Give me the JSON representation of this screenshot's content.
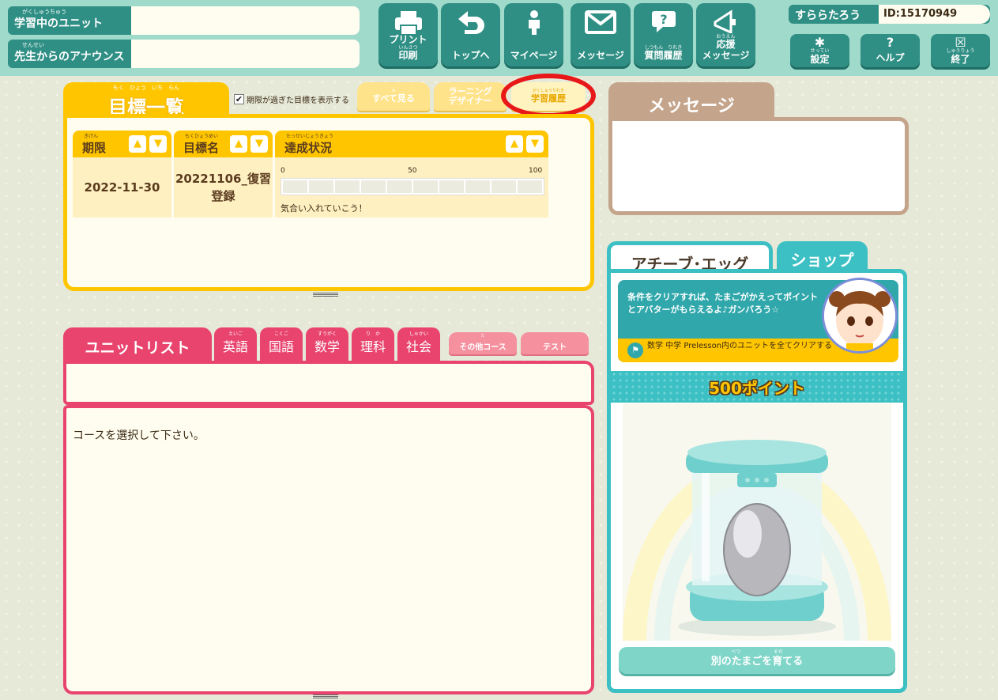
{
  "header": {
    "current_unit": {
      "ruby": "がくしゅうちゅう",
      "label": "学習中のユニット",
      "value": ""
    },
    "announce": {
      "ruby": "せんせい",
      "label": "先生からのアナウンス",
      "value": ""
    },
    "nav": [
      {
        "id": "print",
        "ruby": "いんさつ",
        "label1": "プリント",
        "label2": "印刷",
        "icon": "printer-icon"
      },
      {
        "id": "top",
        "label1": "トップへ",
        "icon": "return-arrow-icon"
      },
      {
        "id": "mypage",
        "label1": "マイページ",
        "icon": "person-icon"
      },
      {
        "id": "message",
        "label1": "メッセージ",
        "icon": "envelope-icon"
      },
      {
        "id": "question",
        "ruby": "しつもん　りれき",
        "label1": "質問履歴",
        "icon": "question-bubble-icon"
      },
      {
        "id": "cheer",
        "ruby": "おうえん",
        "label1": "応援",
        "label2": "メッセージ",
        "icon": "megaphone-icon"
      }
    ],
    "user": {
      "name": "すららたろう",
      "id_text": "ID:15170949"
    },
    "settings": {
      "ruby": "せってい",
      "label": "設定"
    },
    "help": {
      "label": "ヘルプ"
    },
    "exit": {
      "ruby": "しゅうりょう",
      "label": "終了"
    }
  },
  "goals": {
    "tab_ruby": "もく　ひょう　いち　らん",
    "tab_label": "目標一覧",
    "show_expired_label": "期限が過ぎた目標を表示する",
    "show_expired_checked": true,
    "see_all": {
      "ruby": "み",
      "label": "すべて見る"
    },
    "learning_designer": {
      "label1": "ラーニング",
      "label2": "デザイナー"
    },
    "history": {
      "ruby": "がくしゅうりれき",
      "label": "学習履歴"
    },
    "columns": [
      {
        "ruby": "きげん",
        "label": "期限"
      },
      {
        "ruby": "もくひょうめい",
        "label": "目標名"
      },
      {
        "ruby": "たっせいじょうきょう",
        "label": "達成状況"
      }
    ],
    "sort_up": "▲",
    "sort_down": "▼",
    "scale": [
      "0",
      "50",
      "100"
    ],
    "rows": [
      {
        "deadline": "2022-11-30",
        "name1": "20221106_復習",
        "name2": "登録",
        "progress": 0,
        "comment": "気合い入れていこう！"
      }
    ]
  },
  "message": {
    "tab_label": "メッセージ",
    "body": ""
  },
  "units": {
    "tab_label": "ユニットリスト",
    "subjects": [
      {
        "ruby": "えいご",
        "label": "英語"
      },
      {
        "ruby": "こくご",
        "label": "国語"
      },
      {
        "ruby": "すうがく",
        "label": "数学"
      },
      {
        "ruby": "り　か",
        "label": "理科"
      },
      {
        "ruby": "しゃかい",
        "label": "社会"
      }
    ],
    "other": {
      "ruby": "た",
      "label": "その他コース"
    },
    "test": {
      "label": "テスト"
    },
    "empty_text": "コースを選択して下さい。"
  },
  "achieve": {
    "tab_egg": "アチーブ･エッグ",
    "tab_shop": "ショップ",
    "mission_desc": "条件をクリアすれば、たまごがかえってポイントとアバターがもらえるよ♪ガンバろう☆",
    "mission_cond": "数学 中学 Prelesson内のユニットを全てクリアする",
    "points": "500ポイント",
    "grow": {
      "ruby": "べつ　　　　　　　そだ",
      "label": "別のたまごを育てる"
    }
  },
  "colors": {
    "header_bg": "#9fdacb",
    "primary_teal": "#2f8f84",
    "goal_yellow": "#ffc600",
    "unit_pink": "#e8446e",
    "message_tan": "#c4a48a",
    "egg_cyan": "#3cc0c4",
    "highlight_red": "#e81818"
  }
}
